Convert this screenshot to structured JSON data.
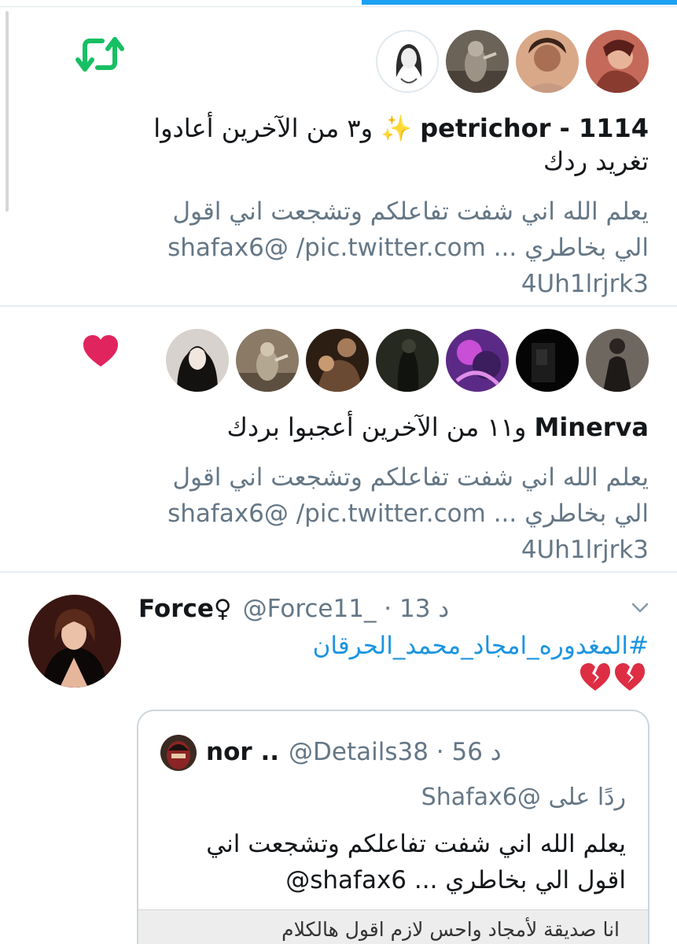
{
  "colors": {
    "accent": "#1da1f2",
    "retweet_green": "#17bf63",
    "like_red": "#e0245e",
    "link_blue": "#1b95e0",
    "secondary_text": "#657786"
  },
  "retweet_notification": {
    "icon": "retweet-icon",
    "avatar_count": 4,
    "summary_name": "petrichor - 1114",
    "summary_emoji": "✨",
    "summary_rest": " و٣ من الآخرين أعادوا تغريد ردك",
    "preview_lines": [
      "يعلم الله اني شفت تفاعلكم وتشجعت اني اقول",
      "الي بخاطري ... shafax6@ /pic.twitter.com",
      "4Uh1lrjrk3"
    ]
  },
  "like_notification": {
    "icon": "heart-icon",
    "avatar_count": 7,
    "summary_name": "Minerva",
    "summary_rest": " و١١ من الآخرين أعجبوا بردك",
    "preview_lines": [
      "يعلم الله اني شفت تفاعلكم وتشجعت اني اقول",
      "الي بخاطري ... shafax6@ /pic.twitter.com",
      "4Uh1lrjrk3"
    ]
  },
  "tweet": {
    "name": "Force♀",
    "meta": "@Force11_ · 13 د",
    "hashtag": "#المغدوره_امجاد_محمد_الحرقان",
    "emoji": "💔💔",
    "quote": {
      "name": "nor ..",
      "meta": "@Details38 · 56 د",
      "reply_to": "ردًا على @Shafax6",
      "body_lines": [
        "يعلم الله اني شفت تفاعلكم وتشجعت اني",
        "اقول الي بخاطري ... shafax6@"
      ],
      "media_text": "انا صديقة لأمجاد واحس لازم اقول هالكلام"
    }
  }
}
